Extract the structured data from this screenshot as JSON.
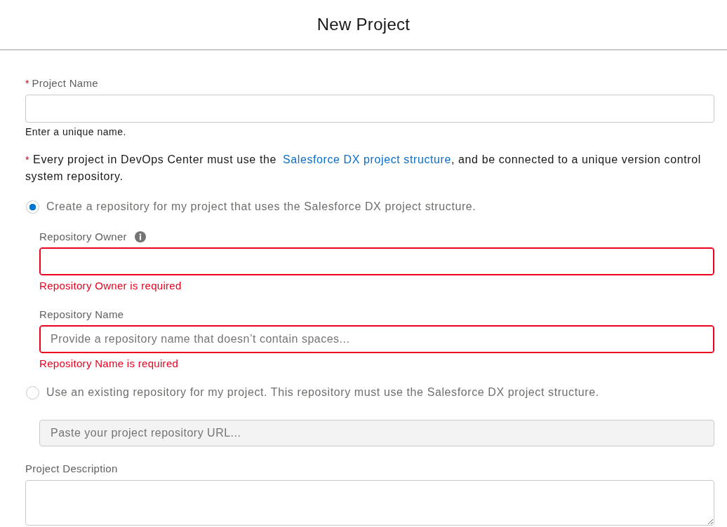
{
  "dialog": {
    "title": "New Project"
  },
  "project_name": {
    "required_mark": "*",
    "label": "Project Name",
    "help": "Enter a unique name."
  },
  "repository_notice": {
    "required_mark": "*",
    "text_before": "Every project in DevOps Center must use the ",
    "link": "Salesforce DX project structure",
    "text_after": ", and be connected to a unique version control system repository."
  },
  "repository_options": [
    {
      "label": "Create a repository for my project that uses the Salesforce DX project structure.",
      "selected": true,
      "fields": [
        {
          "label": "Repository Owner",
          "info_icon": true,
          "disabled": false,
          "error": "Repository Owner is required"
        },
        {
          "label": "Repository Name",
          "info_icon": false,
          "disabled": false,
          "placeholder": "Provide a repository name that doesn’t contain spaces...",
          "error": "Repository Name is required"
        }
      ]
    },
    {
      "label": "Use an existing repository for my project. This repository must use the Salesforce DX project structure.",
      "selected": false,
      "fields": [
        {
          "info_icon": false,
          "disabled": true,
          "placeholder": "Paste your project repository URL..."
        }
      ]
    }
  ],
  "project_description": {
    "label": "Project Description"
  }
}
